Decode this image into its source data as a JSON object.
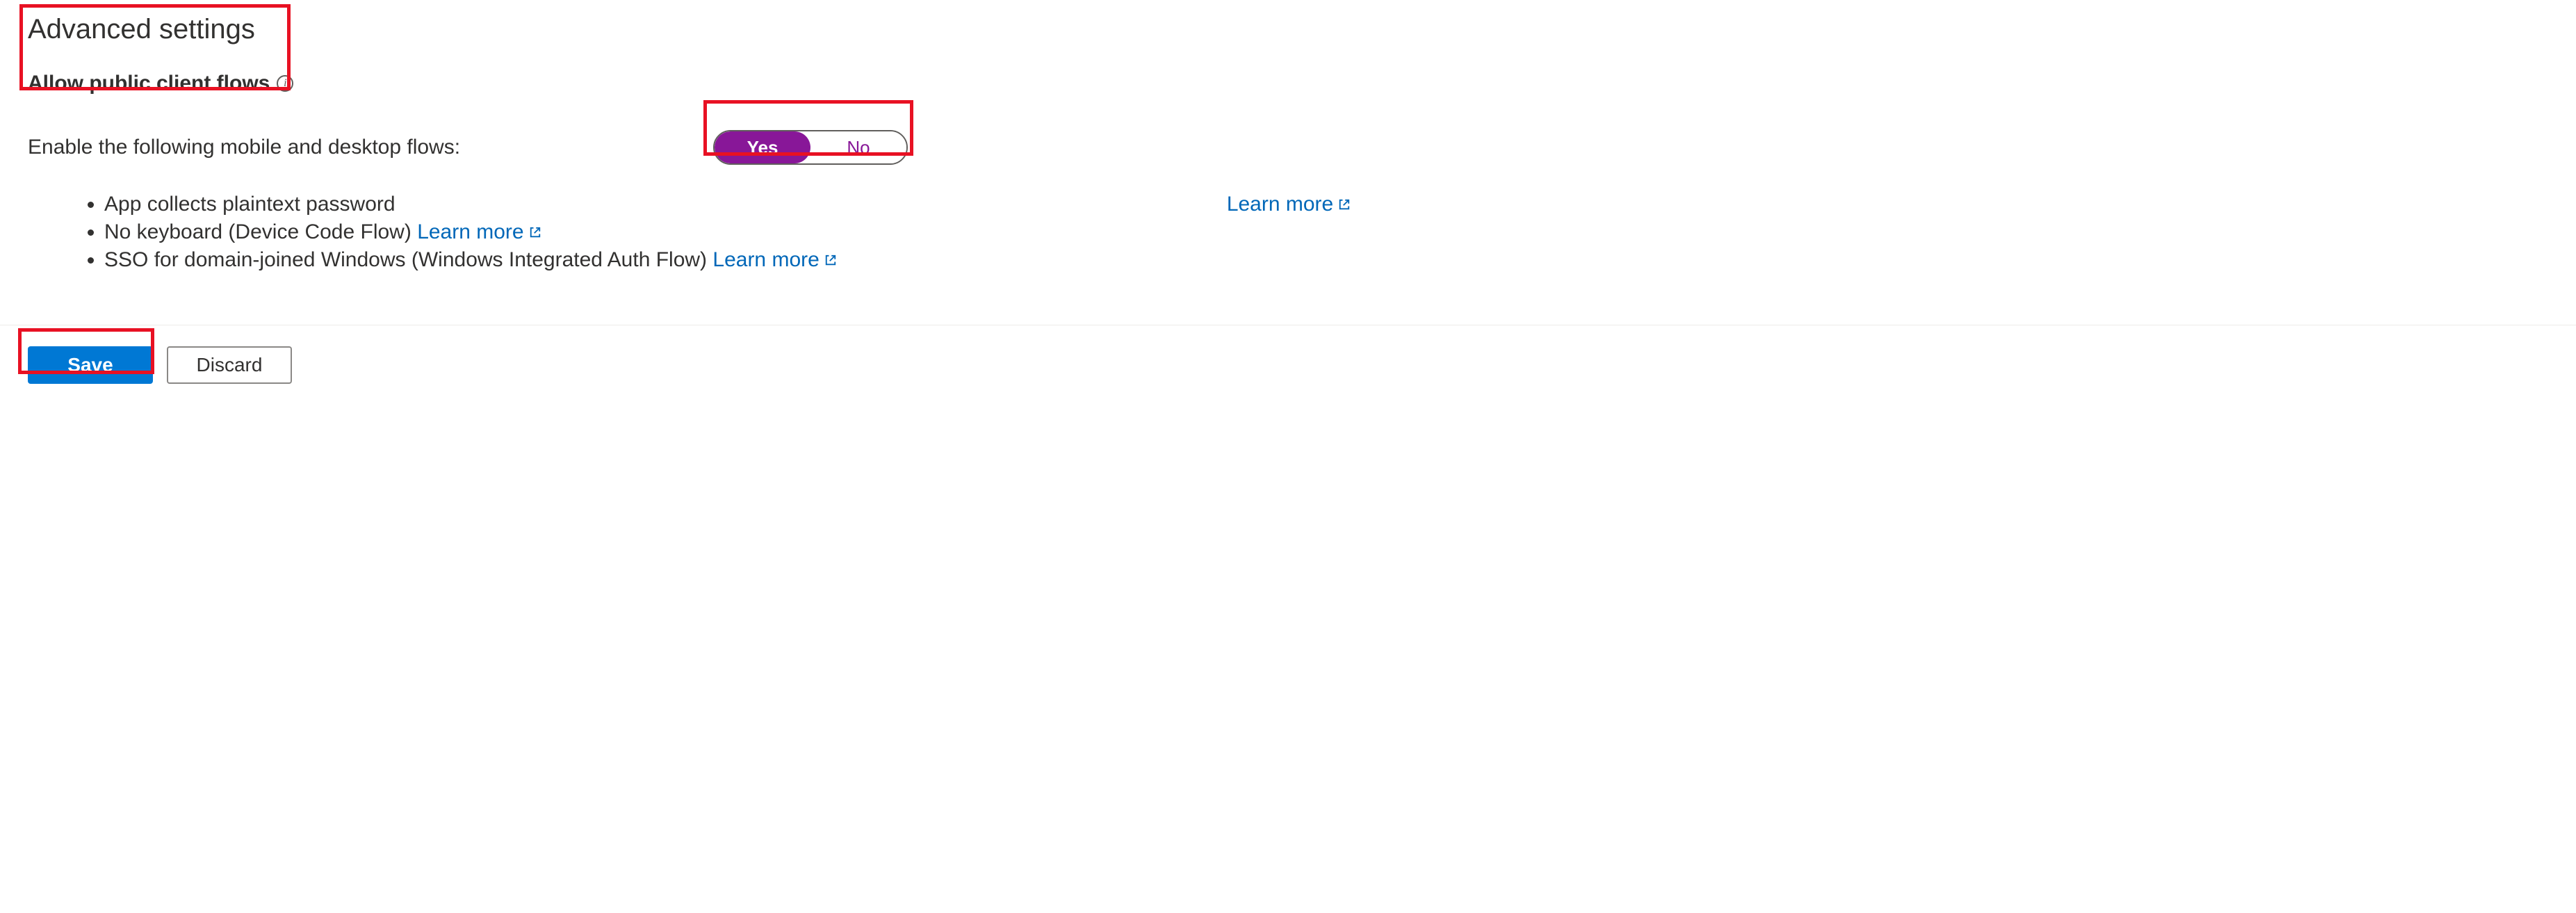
{
  "section": {
    "title": "Advanced settings",
    "subsection": "Allow public client flows"
  },
  "enable": {
    "label": "Enable the following mobile and desktop flows:",
    "toggle": {
      "yes": "Yes",
      "no": "No",
      "selected": "yes"
    }
  },
  "flows": {
    "items": [
      {
        "text": "App collects plaintext password",
        "learn_more": "Learn more",
        "has_link": false
      },
      {
        "text": "No keyboard (Device Code Flow) ",
        "learn_more": "Learn more",
        "has_link": true
      },
      {
        "text": "SSO for domain-joined Windows (Windows Integrated Auth Flow) ",
        "learn_more": "Learn more",
        "has_link": true
      }
    ],
    "side_learn_more": "Learn more"
  },
  "footer": {
    "save": "Save",
    "discard": "Discard"
  }
}
